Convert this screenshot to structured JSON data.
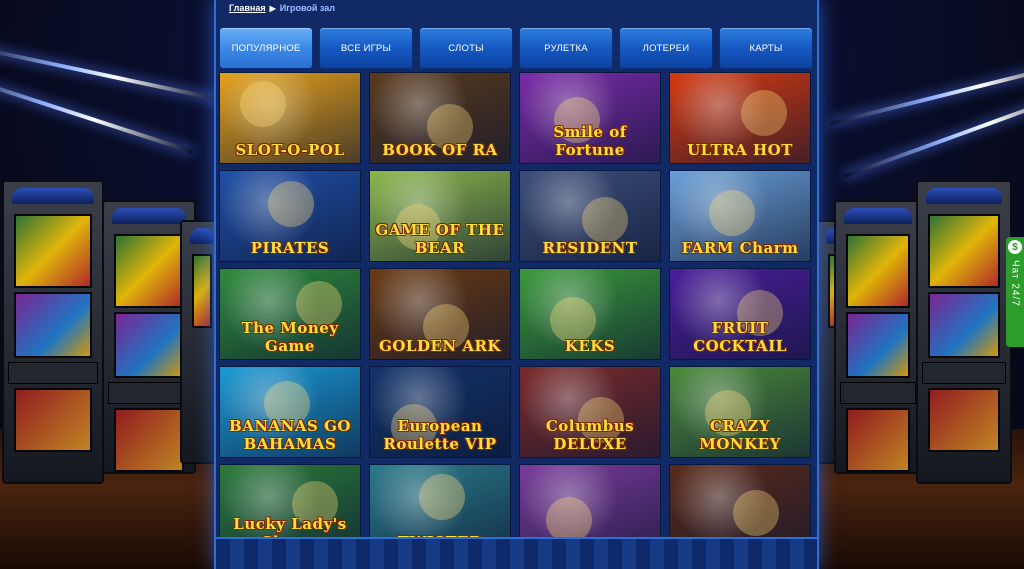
{
  "breadcrumb": {
    "home": "Главная",
    "separator": "▶",
    "current": "Игровой зал"
  },
  "tabs": [
    {
      "label": "ПОПУЛЯРНОЕ",
      "active": true
    },
    {
      "label": "ВСЕ ИГРЫ",
      "active": false
    },
    {
      "label": "СЛОТЫ",
      "active": false
    },
    {
      "label": "РУЛЕТКА",
      "active": false
    },
    {
      "label": "ЛОТЕРЕИ",
      "active": false
    },
    {
      "label": "КАРТЫ",
      "active": false
    }
  ],
  "games": [
    {
      "title": "SLOT-O-POL",
      "bg": "#e7a21a"
    },
    {
      "title": "BOOK OF RA",
      "bg": "#5a3a1c"
    },
    {
      "title": "Smile of Fortune",
      "bg": "#7a2aa8"
    },
    {
      "title": "ULTRA HOT",
      "bg": "#d63a10"
    },
    {
      "title": "PIRATES",
      "bg": "#1f4fa6"
    },
    {
      "title": "GAME OF THE BEAR",
      "bg": "#8bb84a"
    },
    {
      "title": "RESIDENT",
      "bg": "#3b4e7a"
    },
    {
      "title": "FARM Charm",
      "bg": "#6aa0d8"
    },
    {
      "title": "The Money Game",
      "bg": "#2e8a3a"
    },
    {
      "title": "GOLDEN ARK",
      "bg": "#6a3a12"
    },
    {
      "title": "KEKS",
      "bg": "#3a9a3a"
    },
    {
      "title": "FRUIT COCKTAIL",
      "bg": "#4a1e9a"
    },
    {
      "title": "BANANAS GO BAHAMAS",
      "bg": "#1a9ad6"
    },
    {
      "title": "European Roulette VIP",
      "bg": "#12336a"
    },
    {
      "title": "Columbus DELUXE",
      "bg": "#7a2a2a"
    },
    {
      "title": "CRAZY MONKEY",
      "bg": "#4a8a3a"
    },
    {
      "title": "Lucky Lady's Charm",
      "bg": "#2a7a3a"
    },
    {
      "title": "TWISTER",
      "bg": "#2a7a8a"
    },
    {
      "title": "",
      "bg": "#7a3a9a"
    },
    {
      "title": "",
      "bg": "#5a2a1a"
    }
  ],
  "chat": {
    "label": "Чат 24/7",
    "icon": "$"
  },
  "colors": {
    "accent": "#2f6fd6",
    "tab_active": "#3d8ae8",
    "chat": "#2a9d2a"
  }
}
